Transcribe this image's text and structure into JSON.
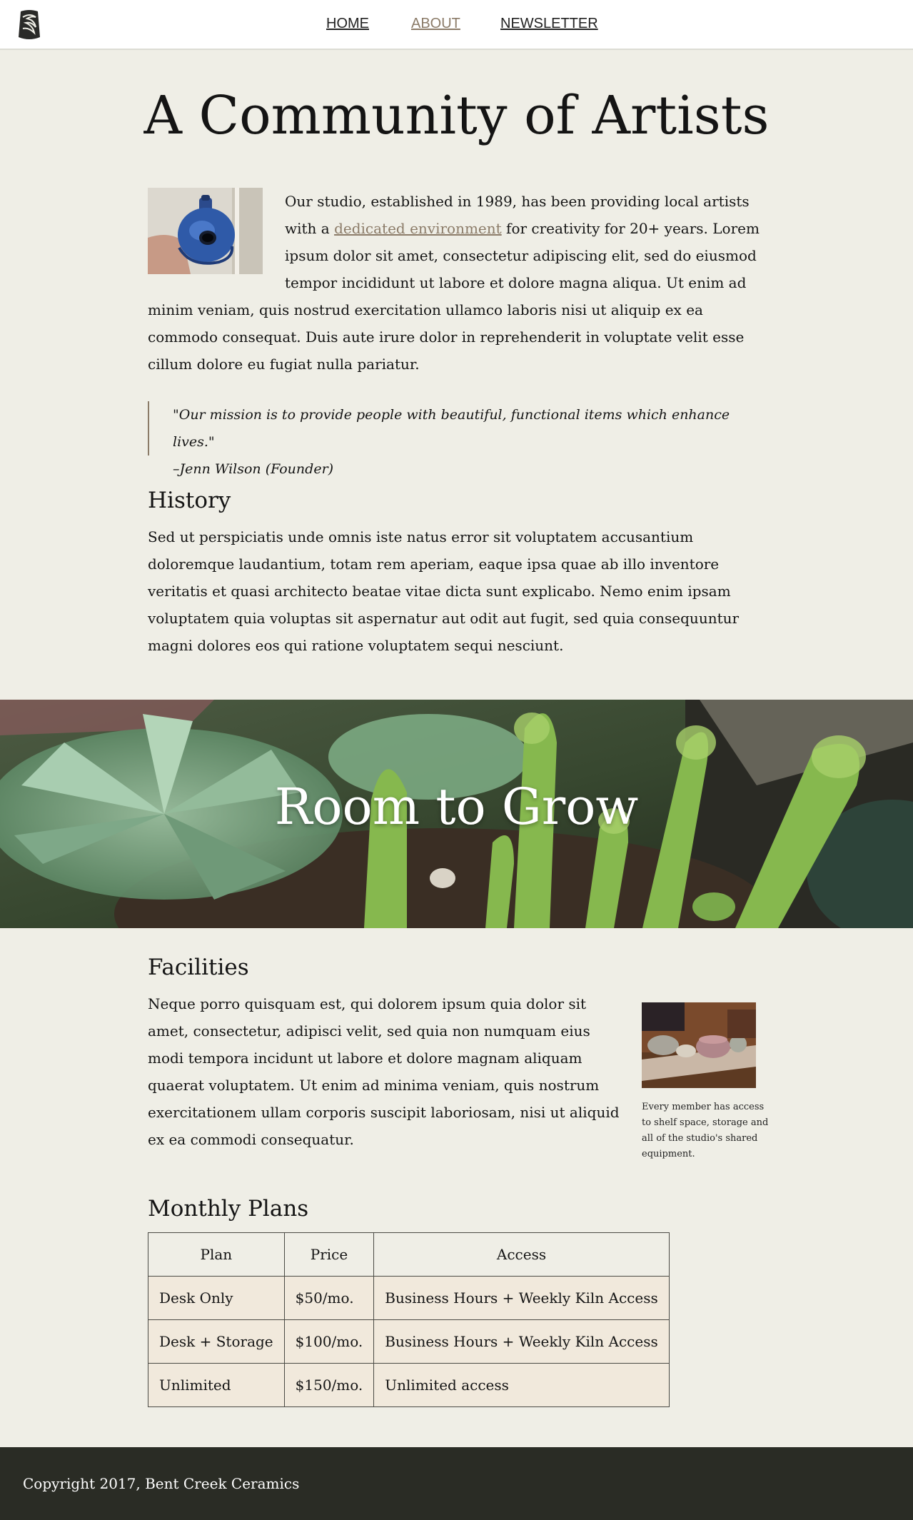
{
  "nav": {
    "links": [
      {
        "label": "HOME"
      },
      {
        "label": "ABOUT",
        "active": true
      },
      {
        "label": "NEWSLETTER"
      }
    ]
  },
  "page_title": "A Community of Artists",
  "intro": {
    "text_before_link": "Our studio, established in 1989, has been providing local artists with a ",
    "link_text": "dedicated environment",
    "text_after_link": " for creativity for 20+ years. Lorem ipsum dolor sit amet, consectetur adipiscing elit, sed do eiusmod tempor incididunt ut labore et dolore magna aliqua. Ut enim ad minim veniam, quis nostrud exercitation ullamco laboris nisi ut aliquip ex ea commodo consequat. Duis aute irure dolor in reprehenderit in voluptate velit esse cillum dolore eu fugiat nulla pariatur."
  },
  "quote": {
    "text": "\"Our mission is to provide people with beautiful, functional items which enhance lives.\"",
    "attribution": "–Jenn Wilson (Founder)"
  },
  "history": {
    "heading": "History",
    "text": "Sed ut perspiciatis unde omnis iste natus error sit voluptatem accusantium doloremque laudantium, totam rem aperiam, eaque ipsa quae ab illo inventore veritatis et quasi architecto beatae vitae dicta sunt explicabo. Nemo enim ipsam voluptatem quia voluptas sit aspernatur aut odit aut fugit, sed quia consequuntur magni dolores eos qui ratione voluptatem sequi nesciunt."
  },
  "hero": {
    "title": "Room to Grow"
  },
  "facilities": {
    "heading": "Facilities",
    "text": "Neque porro quisquam est, qui dolorem ipsum quia dolor sit amet, consectetur, adipisci velit, sed quia non numquam eius modi tempora incidunt ut labore et dolore magnam aliquam quaerat voluptatem. Ut enim ad minima veniam, quis nostrum exercitationem ullam corporis suscipit laboriosam, nisi ut aliquid ex ea commodi consequatur.",
    "caption": "Every member has access to shelf space, storage and all of the studio's shared equipment."
  },
  "plans": {
    "heading": "Monthly Plans",
    "headers": [
      "Plan",
      "Price",
      "Access"
    ],
    "rows": [
      [
        "Desk Only",
        "$50/mo.",
        "Business Hours + Weekly Kiln Access"
      ],
      [
        "Desk + Storage",
        "$100/mo.",
        "Business Hours + Weekly Kiln Access"
      ],
      [
        "Unlimited",
        "$150/mo.",
        "Unlimited access"
      ]
    ]
  },
  "footer": {
    "text": "Copyright 2017, Bent Creek Ceramics"
  },
  "colors": {
    "background": "#efeee6",
    "accent": "#8b7b68",
    "footer": "#2a2c25",
    "table_cell": "#f1e9dc"
  },
  "icons": {
    "logo": "swirl-logo-icon"
  }
}
